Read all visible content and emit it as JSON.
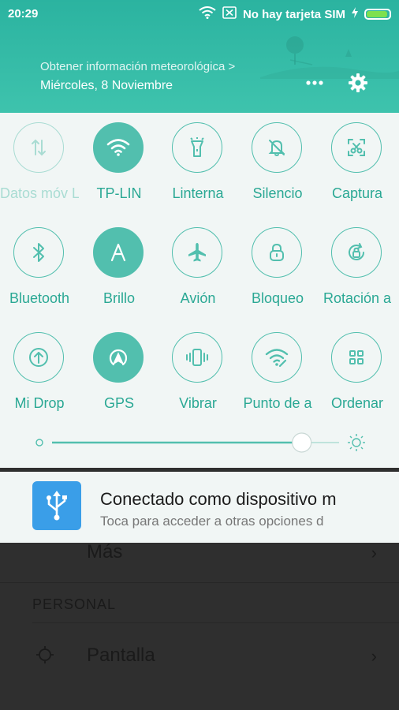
{
  "status_bar": {
    "time": "20:29",
    "sim_text": "No hay tarjeta SIM",
    "battery_level": 0.92,
    "icons": [
      "wifi-icon",
      "no-sim-icon",
      "charging-bolt-icon",
      "battery-icon"
    ]
  },
  "header": {
    "weather_link": "Obtener información meteorológica >",
    "date": "Miércoles, 8 Noviembre",
    "more_icon": "more-icon",
    "settings_icon": "gear-icon"
  },
  "quick_settings": {
    "tiles": [
      {
        "label": "Datos móv L",
        "icon": "mobile-data-icon",
        "state": "off"
      },
      {
        "label": "TP-LIN",
        "icon": "wifi-icon",
        "state": "on"
      },
      {
        "label": "Linterna",
        "icon": "flashlight-icon",
        "state": "idle"
      },
      {
        "label": "Silencio",
        "icon": "silent-bell-icon",
        "state": "idle"
      },
      {
        "label": "Captura",
        "icon": "screenshot-scissors-icon",
        "state": "idle"
      },
      {
        "label": "Bluetooth",
        "icon": "bluetooth-icon",
        "state": "idle"
      },
      {
        "label": "Brillo",
        "icon": "auto-brightness-icon",
        "state": "on"
      },
      {
        "label": "Avión",
        "icon": "airplane-icon",
        "state": "idle"
      },
      {
        "label": "Bloqueo",
        "icon": "lock-icon",
        "state": "idle"
      },
      {
        "label": "Rotación a",
        "icon": "rotation-icon",
        "state": "idle"
      },
      {
        "label": "Mi Drop",
        "icon": "mi-drop-icon",
        "state": "idle"
      },
      {
        "label": "GPS",
        "icon": "gps-icon",
        "state": "on"
      },
      {
        "label": "Vibrar",
        "icon": "vibrate-icon",
        "state": "idle"
      },
      {
        "label": "Punto de a",
        "icon": "hotspot-icon",
        "state": "idle"
      },
      {
        "label": "Ordenar",
        "icon": "grid-icon",
        "state": "idle"
      }
    ],
    "brightness": 0.87
  },
  "notification": {
    "title": "Conectado como dispositivo m",
    "subtitle": "Toca para acceder a otras opciones d",
    "icon": "usb-icon"
  },
  "background_settings": {
    "item_more": "Más",
    "section_personal": "PERSONAL",
    "item_display": "Pantalla"
  },
  "colors": {
    "accent": "#52bfae",
    "header": "#2bb3a0",
    "panel": "#f1f6f5",
    "usb_icon_bg": "#3a9ee8"
  }
}
